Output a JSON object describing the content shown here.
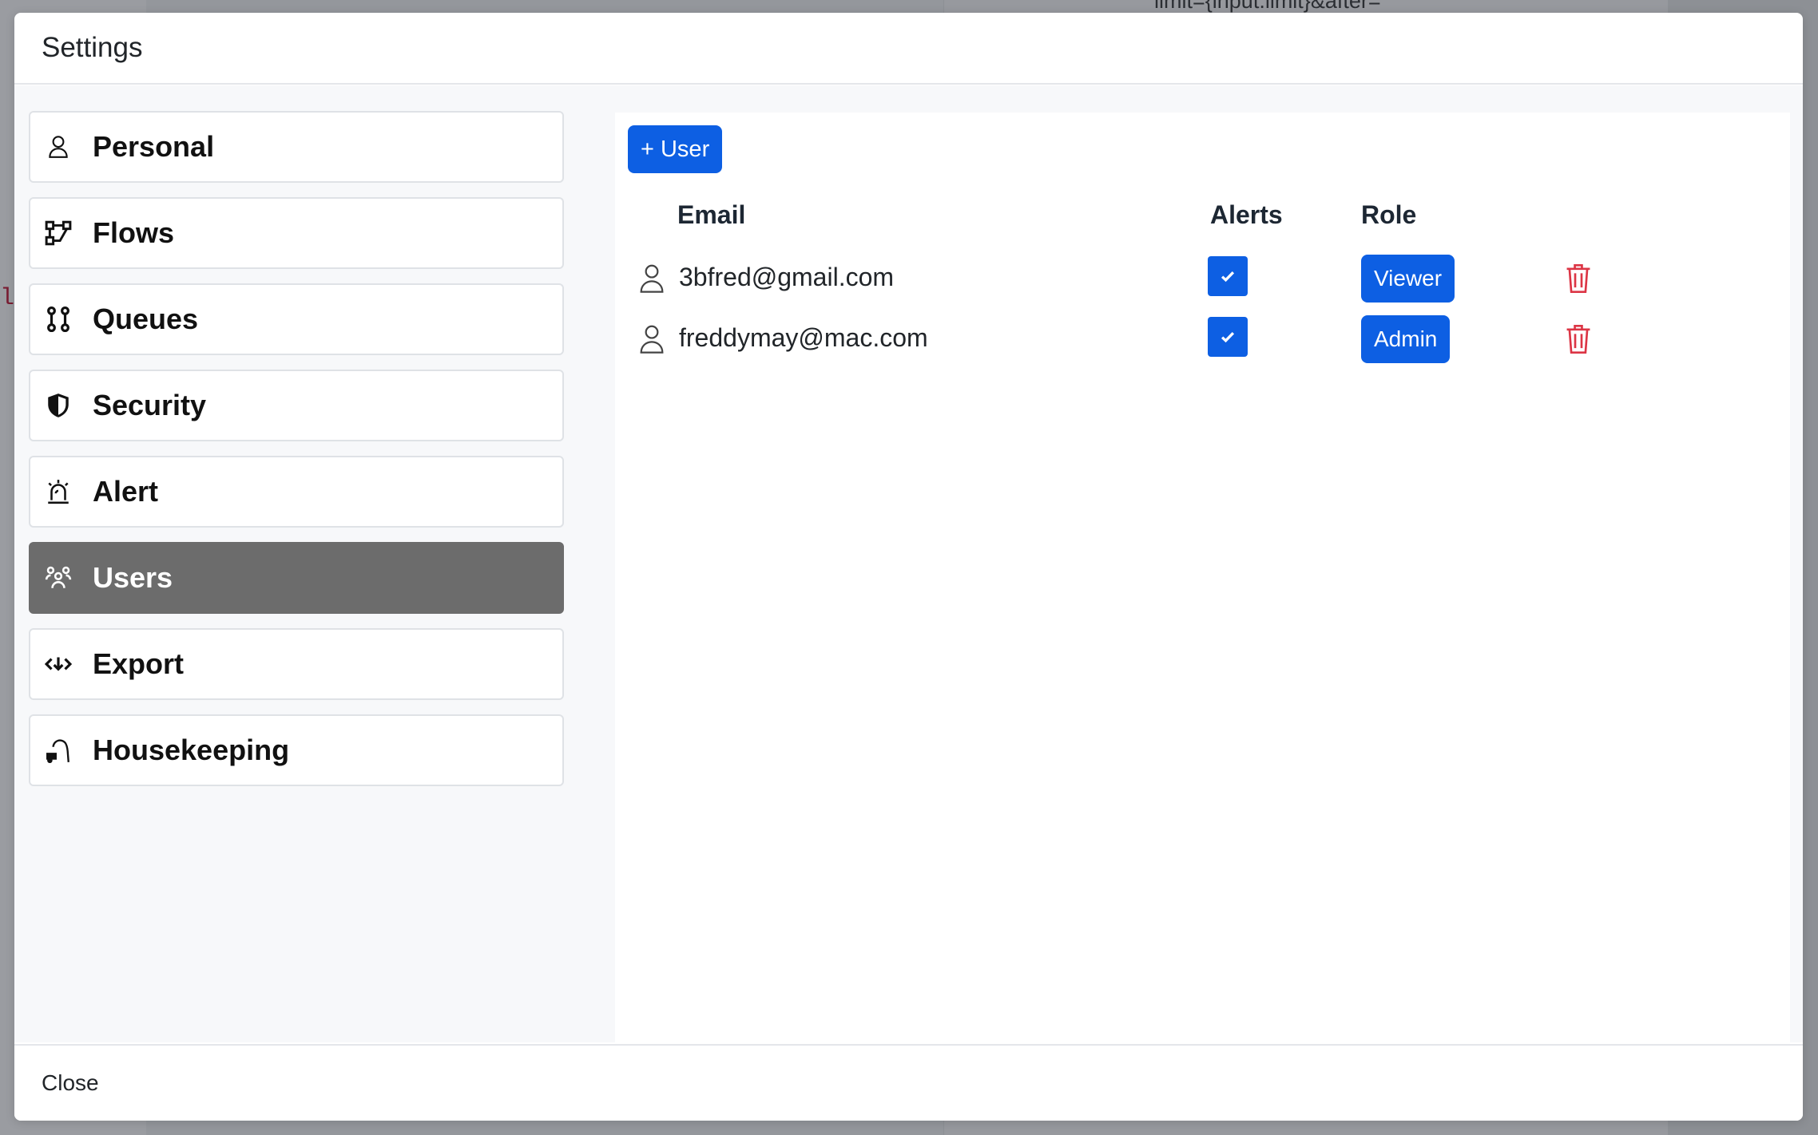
{
  "background": {
    "snippet": "limit={input.limit}&after=",
    "code_fragment": "l"
  },
  "modal": {
    "title": "Settings",
    "close_label": "Close"
  },
  "sidebar": {
    "items": [
      {
        "label": "Personal",
        "icon": "person-icon",
        "active": false
      },
      {
        "label": "Flows",
        "icon": "flows-icon",
        "active": false
      },
      {
        "label": "Queues",
        "icon": "queues-icon",
        "active": false
      },
      {
        "label": "Security",
        "icon": "shield-icon",
        "active": false
      },
      {
        "label": "Alert",
        "icon": "alarm-icon",
        "active": false
      },
      {
        "label": "Users",
        "icon": "users-icon",
        "active": true
      },
      {
        "label": "Export",
        "icon": "export-icon",
        "active": false
      },
      {
        "label": "Housekeeping",
        "icon": "vacuum-icon",
        "active": false
      }
    ]
  },
  "users": {
    "add_label": "+ User",
    "columns": {
      "email": "Email",
      "alerts": "Alerts",
      "role": "Role"
    },
    "rows": [
      {
        "email": "3bfred@gmail.com",
        "alerts": true,
        "role": "Viewer"
      },
      {
        "email": "freddymay@mac.com",
        "alerts": true,
        "role": "Admin"
      }
    ]
  },
  "colors": {
    "accent": "#0d5fe3",
    "danger": "#dc3545",
    "active_nav": "#6c6c6c"
  }
}
